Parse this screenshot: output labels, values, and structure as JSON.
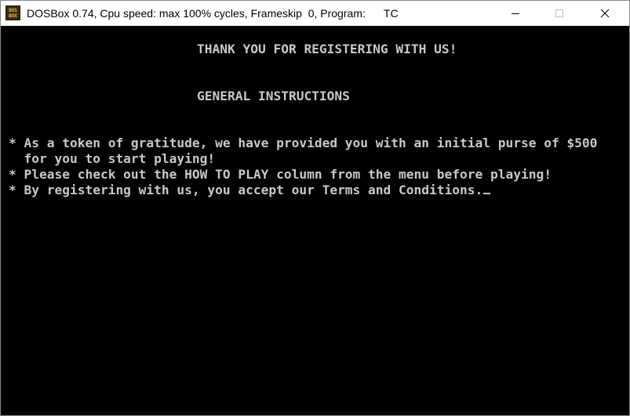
{
  "window": {
    "title": "DOSBox 0.74, Cpu speed: max 100% cycles, Frameskip  0, Program:      TC",
    "icon_label_top": "DOS",
    "icon_label_bottom": "BOX",
    "icon": "dosbox-app-icon",
    "controls": {
      "minimize_icon": "minimize-icon",
      "maximize_icon": "maximize-icon",
      "close_icon": "close-icon"
    }
  },
  "screen": {
    "heading": "THANK YOU FOR REGISTERING WITH US!",
    "subheading": "GENERAL INSTRUCTIONS",
    "instructions": [
      "* As a token of gratitude, we have provided you with an initial purse of $500",
      "  for you to start playing!",
      "* Please check out the HOW TO PLAY column from the menu before playing!",
      "* By registering with us, you accept our Terms and Conditions."
    ],
    "text_color": "#c8c8c8",
    "background_color": "#000000"
  }
}
